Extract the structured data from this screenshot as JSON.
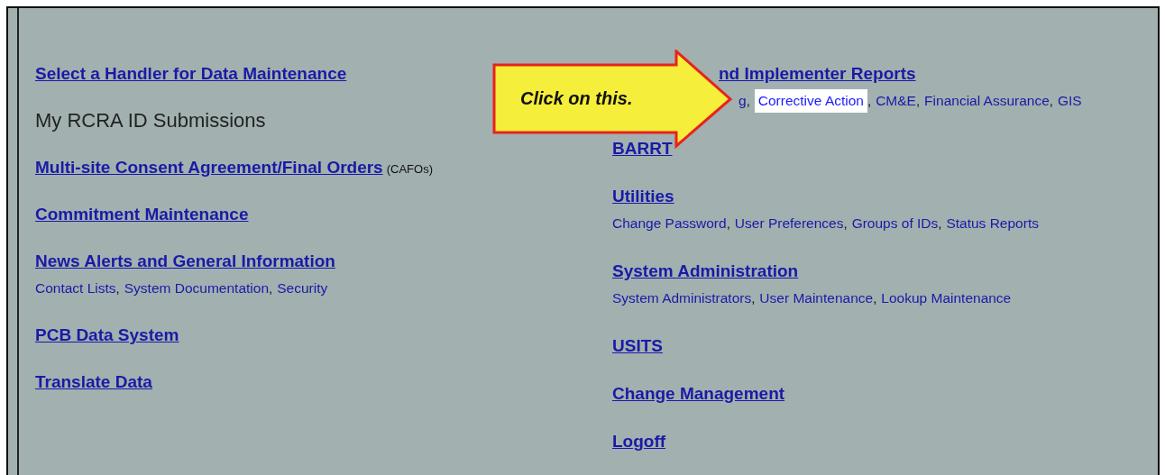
{
  "callout": {
    "text": "Click on this."
  },
  "left_column": [
    {
      "kind": "link",
      "label": "Select a Handler for Data Maintenance"
    },
    {
      "kind": "text",
      "label": "My RCRA ID Submissions"
    },
    {
      "kind": "link",
      "label": "Multi-site Consent Agreement/Final Orders",
      "note": "(CAFOs)"
    },
    {
      "kind": "link",
      "label": "Commitment Maintenance"
    },
    {
      "kind": "link",
      "label": "News Alerts and General Information",
      "separator": ",",
      "sublinks": [
        {
          "label": "Contact Lists",
          "highlighted": false
        },
        {
          "label": "System Documentation",
          "highlighted": false
        },
        {
          "label": "Security",
          "highlighted": false
        }
      ]
    },
    {
      "kind": "link",
      "label": "PCB Data System"
    },
    {
      "kind": "link",
      "label": "Translate Data"
    }
  ],
  "right_column": [
    {
      "kind": "link",
      "label": "nd Implementer Reports",
      "covered": true,
      "separator": ",",
      "sublinks": [
        {
          "label": "g",
          "highlighted": false
        },
        {
          "label": "Corrective Action",
          "highlighted": true
        },
        {
          "label": "CM&E",
          "highlighted": false
        },
        {
          "label": "Financial Assurance",
          "highlighted": false
        },
        {
          "label": "GIS",
          "highlighted": false
        }
      ]
    },
    {
      "kind": "link",
      "label": "BARRT"
    },
    {
      "kind": "link",
      "label": "Utilities",
      "separator": ",",
      "sublinks": [
        {
          "label": "Change Password",
          "highlighted": false
        },
        {
          "label": "User Preferences",
          "highlighted": false
        },
        {
          "label": "Groups of IDs",
          "highlighted": false
        },
        {
          "label": "Status Reports",
          "highlighted": false
        }
      ]
    },
    {
      "kind": "link",
      "label": "System Administration",
      "separator": ",",
      "sublinks": [
        {
          "label": "System Administrators",
          "highlighted": false
        },
        {
          "label": "User Maintenance",
          "highlighted": false
        },
        {
          "label": "Lookup Maintenance",
          "highlighted": false
        }
      ]
    },
    {
      "kind": "link",
      "label": "USITS"
    },
    {
      "kind": "link",
      "label": "Change Management"
    },
    {
      "kind": "link",
      "label": "Logoff"
    }
  ]
}
